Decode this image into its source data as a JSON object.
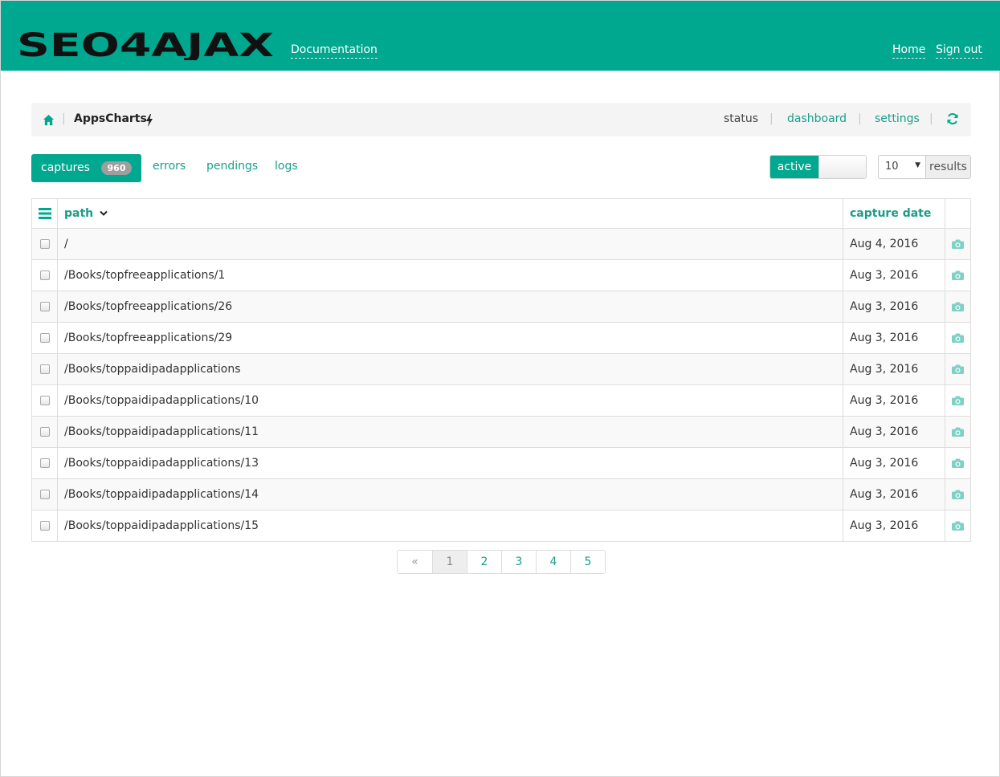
{
  "header": {
    "logo_text": "SEO4AJAX",
    "doc_link": "Documentation",
    "home_link": "Home",
    "signout_link": "Sign out",
    "colors": {
      "brand": "#00a88f"
    }
  },
  "breadcrumb": {
    "separator": "|",
    "app_name": "AppsCharts",
    "links": [
      "status",
      "dashboard",
      "settings"
    ]
  },
  "tabs": {
    "captures": {
      "label": "captures",
      "count": "960"
    },
    "errors": "errors",
    "pendings": "pendings",
    "logs": "logs"
  },
  "filters": {
    "toggle_label": "active",
    "page_size": "10",
    "results_label": "results"
  },
  "table": {
    "headers": {
      "path": "path",
      "capture_date": "capture date"
    },
    "rows": [
      {
        "path": "/",
        "date": "Aug 4, 2016"
      },
      {
        "path": "/Books/topfreeapplications/1",
        "date": "Aug 3, 2016"
      },
      {
        "path": "/Books/topfreeapplications/26",
        "date": "Aug 3, 2016"
      },
      {
        "path": "/Books/topfreeapplications/29",
        "date": "Aug 3, 2016"
      },
      {
        "path": "/Books/toppaidipadapplications",
        "date": "Aug 3, 2016"
      },
      {
        "path": "/Books/toppaidipadapplications/10",
        "date": "Aug 3, 2016"
      },
      {
        "path": "/Books/toppaidipadapplications/11",
        "date": "Aug 3, 2016"
      },
      {
        "path": "/Books/toppaidipadapplications/13",
        "date": "Aug 3, 2016"
      },
      {
        "path": "/Books/toppaidipadapplications/14",
        "date": "Aug 3, 2016"
      },
      {
        "path": "/Books/toppaidipadapplications/15",
        "date": "Aug 3, 2016"
      }
    ]
  },
  "pagination": {
    "prev": "«",
    "pages": [
      "1",
      "2",
      "3",
      "4",
      "5"
    ],
    "current": "1"
  }
}
